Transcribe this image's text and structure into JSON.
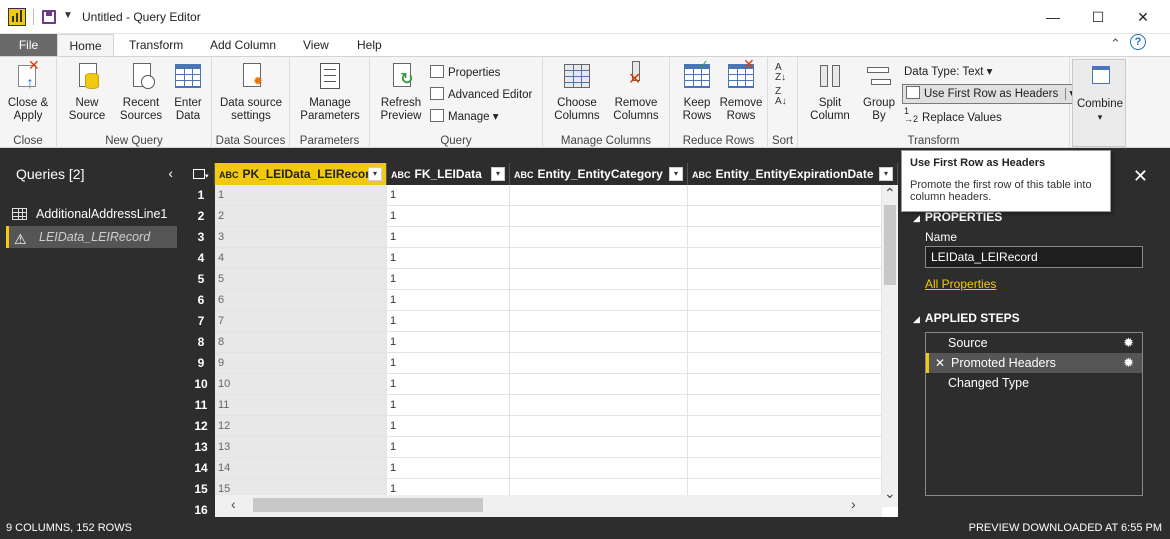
{
  "window": {
    "title": "Untitled - Query Editor",
    "minimize": "—",
    "maximize": "☐",
    "close": "✕"
  },
  "tabs": [
    {
      "label": "File"
    },
    {
      "label": "Home"
    },
    {
      "label": "Transform"
    },
    {
      "label": "Add Column"
    },
    {
      "label": "View"
    },
    {
      "label": "Help"
    }
  ],
  "ribbon": {
    "close_group": {
      "label": "Close",
      "close_apply": "Close &\nApply"
    },
    "new_query_group": {
      "label": "New Query",
      "new_source": "New\nSource",
      "recent_sources": "Recent\nSources",
      "enter_data": "Enter\nData"
    },
    "data_sources_group": {
      "label": "Data Sources",
      "data_source_settings": "Data source\nsettings"
    },
    "parameters_group": {
      "label": "Parameters",
      "manage_parameters": "Manage\nParameters"
    },
    "query_group": {
      "label": "Query",
      "refresh_preview": "Refresh\nPreview",
      "properties": "Properties",
      "advanced_editor": "Advanced Editor",
      "manage": "Manage"
    },
    "manage_columns_group": {
      "label": "Manage Columns",
      "choose_columns": "Choose\nColumns",
      "remove_columns": "Remove\nColumns"
    },
    "reduce_rows_group": {
      "label": "Reduce Rows",
      "keep_rows": "Keep\nRows",
      "remove_rows": "Remove\nRows"
    },
    "sort_group": {
      "label": "Sort"
    },
    "transform_group": {
      "label": "Transform",
      "split_column": "Split\nColumn",
      "group_by": "Group\nBy",
      "data_type": "Data Type: Text",
      "use_first_row": "Use First Row as Headers",
      "replace_values": "Replace Values"
    },
    "combine_group": {
      "combine": "Combine"
    }
  },
  "queries": {
    "title": "Queries [2]",
    "items": [
      {
        "label": "AdditionalAddressLine1",
        "icon": "table-icon"
      },
      {
        "label": "LEIData_LEIRecord",
        "icon": "warning-icon"
      }
    ]
  },
  "grid": {
    "columns": [
      {
        "name": "PK_LEIData_LEIRecord",
        "type": "ABC"
      },
      {
        "name": "FK_LEIData",
        "type": "ABC"
      },
      {
        "name": "Entity_EntityCategory",
        "type": "ABC"
      },
      {
        "name": "Entity_EntityExpirationDate",
        "type": "ABC"
      }
    ],
    "rows": [
      [
        "1",
        "1"
      ],
      [
        "2",
        "1"
      ],
      [
        "3",
        "1"
      ],
      [
        "4",
        "1"
      ],
      [
        "5",
        "1"
      ],
      [
        "6",
        "1"
      ],
      [
        "7",
        "1"
      ],
      [
        "8",
        "1"
      ],
      [
        "9",
        "1"
      ],
      [
        "10",
        "1"
      ],
      [
        "11",
        "1"
      ],
      [
        "12",
        "1"
      ],
      [
        "13",
        "1"
      ],
      [
        "14",
        "1"
      ],
      [
        "15",
        "1"
      ],
      [
        "",
        ""
      ]
    ],
    "row_numbers": [
      "1",
      "2",
      "3",
      "4",
      "5",
      "6",
      "7",
      "8",
      "9",
      "10",
      "11",
      "12",
      "13",
      "14",
      "15",
      "16"
    ]
  },
  "tooltip": {
    "title": "Use First Row as Headers",
    "body": "Promote the first row of this table into column headers."
  },
  "settings": {
    "properties_head": "PROPERTIES",
    "name_label": "Name",
    "name_value": "LEIData_LEIRecord",
    "all_properties": "All Properties",
    "applied_steps_head": "APPLIED STEPS",
    "steps": [
      {
        "label": "Source"
      },
      {
        "label": "Promoted Headers"
      },
      {
        "label": "Changed Type"
      }
    ]
  },
  "status": {
    "left": "9 COLUMNS, 152 ROWS",
    "right": "PREVIEW DOWNLOADED AT 6:55 PM"
  },
  "colors": {
    "accent": "#f2c811",
    "dark_pane": "#2d2d2d"
  }
}
